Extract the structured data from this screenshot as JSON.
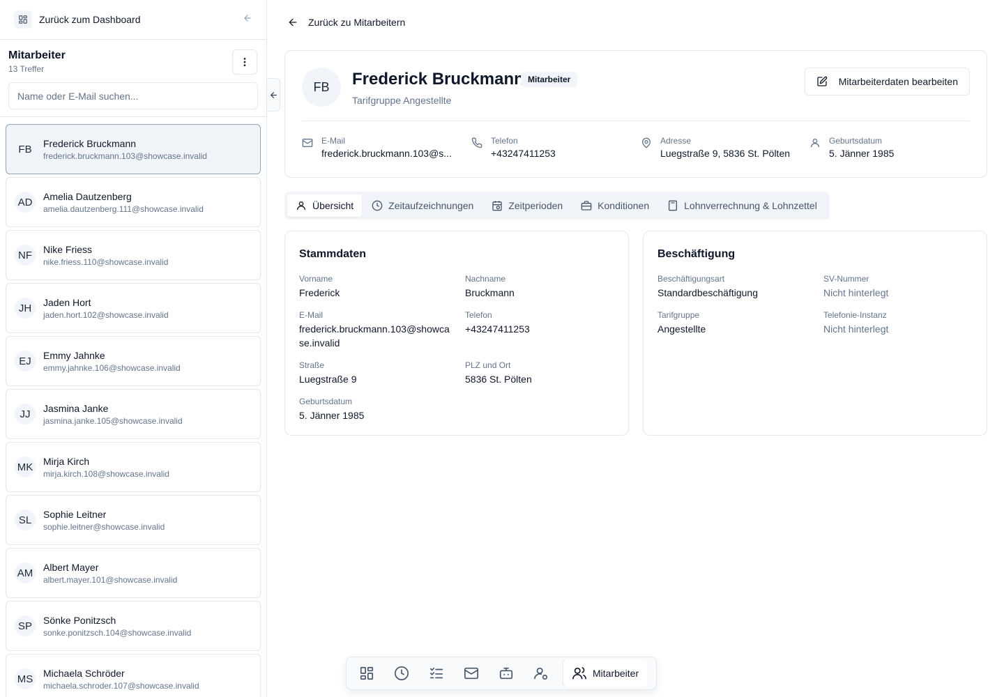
{
  "sidebar": {
    "back_label": "Zurück zum Dashboard",
    "title": "Mitarbeiter",
    "count": "13 Treffer",
    "search_placeholder": "Name oder E-Mail suchen...",
    "employees": [
      {
        "initials": "FB",
        "name": "Frederick Bruckmann",
        "email": "frederick.bruckmann.103@showcase.invalid",
        "active": true
      },
      {
        "initials": "AD",
        "name": "Amelia Dautzenberg",
        "email": "amelia.dautzenberg.111@showcase.invalid"
      },
      {
        "initials": "NF",
        "name": "Nike Friess",
        "email": "nike.friess.110@showcase.invalid"
      },
      {
        "initials": "JH",
        "name": "Jaden Hort",
        "email": "jaden.hort.102@showcase.invalid"
      },
      {
        "initials": "EJ",
        "name": "Emmy Jahnke",
        "email": "emmy.jahnke.106@showcase.invalid"
      },
      {
        "initials": "JJ",
        "name": "Jasmina Janke",
        "email": "jasmina.janke.105@showcase.invalid"
      },
      {
        "initials": "MK",
        "name": "Mirja Kirch",
        "email": "mirja.kirch.108@showcase.invalid"
      },
      {
        "initials": "SL",
        "name": "Sophie Leitner",
        "email": "sophie.leitner@showcase.invalid"
      },
      {
        "initials": "AM",
        "name": "Albert Mayer",
        "email": "albert.mayer.101@showcase.invalid"
      },
      {
        "initials": "SP",
        "name": "Sönke Ponitzsch",
        "email": "sonke.ponitzsch.104@showcase.invalid"
      },
      {
        "initials": "MS",
        "name": "Michaela Schröder",
        "email": "michaela.schroder.107@showcase.invalid"
      }
    ]
  },
  "main": {
    "back_label": "Zurück zu Mitarbeitern",
    "profile": {
      "initials": "FB",
      "name": "Frederick Bruckmann",
      "badge": "Mitarbeiter",
      "subtitle": "Tarifgruppe Angestellte",
      "edit_label": "Mitarbeiterdaten bearbeiten",
      "email_label": "E-Mail",
      "email_value": "frederick.bruckmann.103@s...",
      "phone_label": "Telefon",
      "phone_value": "+43247411253",
      "address_label": "Adresse",
      "address_value": "Luegstraße 9, 5836 St. Pölten",
      "birth_label": "Geburtsdatum",
      "birth_value": "5. Jänner 1985"
    },
    "tabs": [
      "Übersicht",
      "Zeitaufzeichnungen",
      "Zeitperioden",
      "Konditionen",
      "Lohnverrechnung & Lohnzettel"
    ],
    "stammdaten": {
      "title": "Stammdaten",
      "vorname_label": "Vorname",
      "vorname": "Frederick",
      "nachname_label": "Nachname",
      "nachname": "Bruckmann",
      "email_label": "E-Mail",
      "email": "frederick.bruckmann.103@showcase.invalid",
      "telefon_label": "Telefon",
      "telefon": "+43247411253",
      "strasse_label": "Straße",
      "strasse": "Luegstraße 9",
      "plz_label": "PLZ und Ort",
      "plz": "5836 St. Pölten",
      "geburt_label": "Geburtsdatum",
      "geburt": "5. Jänner 1985"
    },
    "beschaeftigung": {
      "title": "Beschäftigung",
      "art_label": "Beschäftigungsart",
      "art": "Standardbeschäftigung",
      "sv_label": "SV-Nummer",
      "sv": "Nicht hinterlegt",
      "tarif_label": "Tarifgruppe",
      "tarif": "Angestellte",
      "tel_label": "Telefonie-Instanz",
      "tel": "Nicht hinterlegt"
    }
  },
  "dock": {
    "items": [
      "dashboard-icon",
      "clock-icon",
      "checklist-icon",
      "mail-icon",
      "bot-icon",
      "user-settings-icon"
    ],
    "active_label": "Mitarbeiter"
  }
}
